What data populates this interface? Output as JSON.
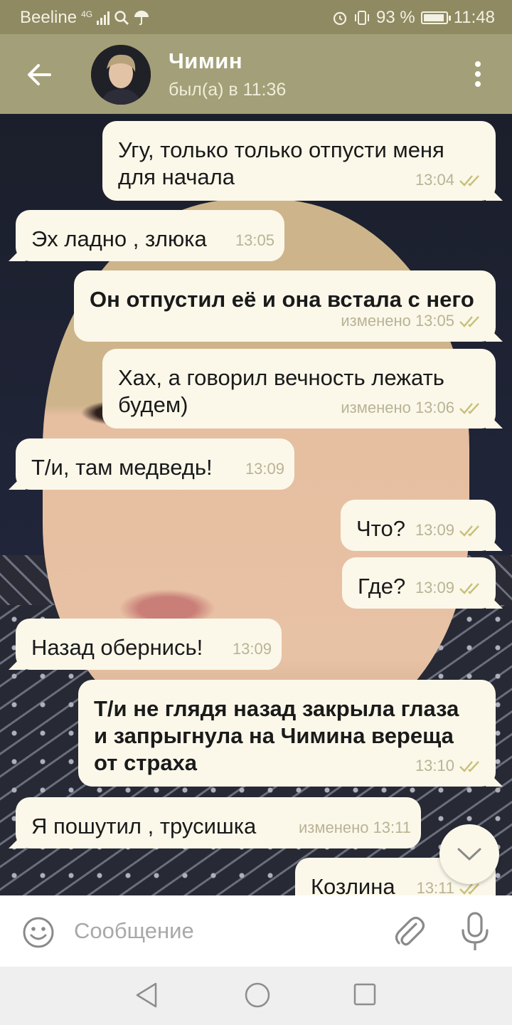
{
  "status_bar": {
    "carrier": "Beeline",
    "network": "4G",
    "battery": "93 %",
    "battery_level": 0.93,
    "time": "11:48"
  },
  "header": {
    "name": "Чимин",
    "status": "был(а) в 11:36"
  },
  "messages": [
    {
      "dir": "out",
      "text": "Угу, только только отпусти меня\nдля начала",
      "meta": "13:04",
      "read": true,
      "bold": false
    },
    {
      "dir": "in",
      "text": "Эх ладно , злюка",
      "meta": "13:05",
      "bold": false
    },
    {
      "dir": "out",
      "text": "Он отпустил её и она встала с него",
      "meta": "изменено 13:05",
      "read": true,
      "bold": true
    },
    {
      "dir": "out",
      "text": "Хах, а говорил вечность лежать\nбудем)",
      "meta": "изменено 13:06",
      "read": true,
      "bold": false
    },
    {
      "dir": "in",
      "text": "Т/и, там медведь!",
      "meta": "13:09",
      "bold": false
    },
    {
      "dir": "out",
      "text": "Что?",
      "meta": "13:09",
      "read": true,
      "bold": false
    },
    {
      "dir": "out",
      "text": "Где?",
      "meta": "13:09",
      "read": true,
      "bold": false
    },
    {
      "dir": "in",
      "text": "Назад обернись!",
      "meta": "13:09",
      "bold": false
    },
    {
      "dir": "out",
      "text": "Т/и не глядя назад закрыла глаза\nи запрыгнула на Чимина вереща\nот страха",
      "meta": "13:10",
      "read": true,
      "bold": true
    },
    {
      "dir": "in",
      "text": "Я пошутил , трусишка",
      "meta": "изменено 13:11",
      "bold": false
    },
    {
      "dir": "out",
      "text": "Козлина",
      "meta": "13:11",
      "read": true,
      "bold": false
    }
  ],
  "input": {
    "placeholder": "Сообщение",
    "value": ""
  },
  "colors": {
    "header": "#a39f78",
    "status_bar": "#8f8a62",
    "bubble": "#fbf8ea",
    "check": "#c9c07a"
  },
  "icons": [
    "back-arrow-icon",
    "more-vertical-icon",
    "double-check-icon",
    "chevron-down-icon",
    "emoji-icon",
    "paperclip-icon",
    "microphone-icon",
    "nav-back-icon",
    "nav-home-icon",
    "nav-recent-icon"
  ]
}
